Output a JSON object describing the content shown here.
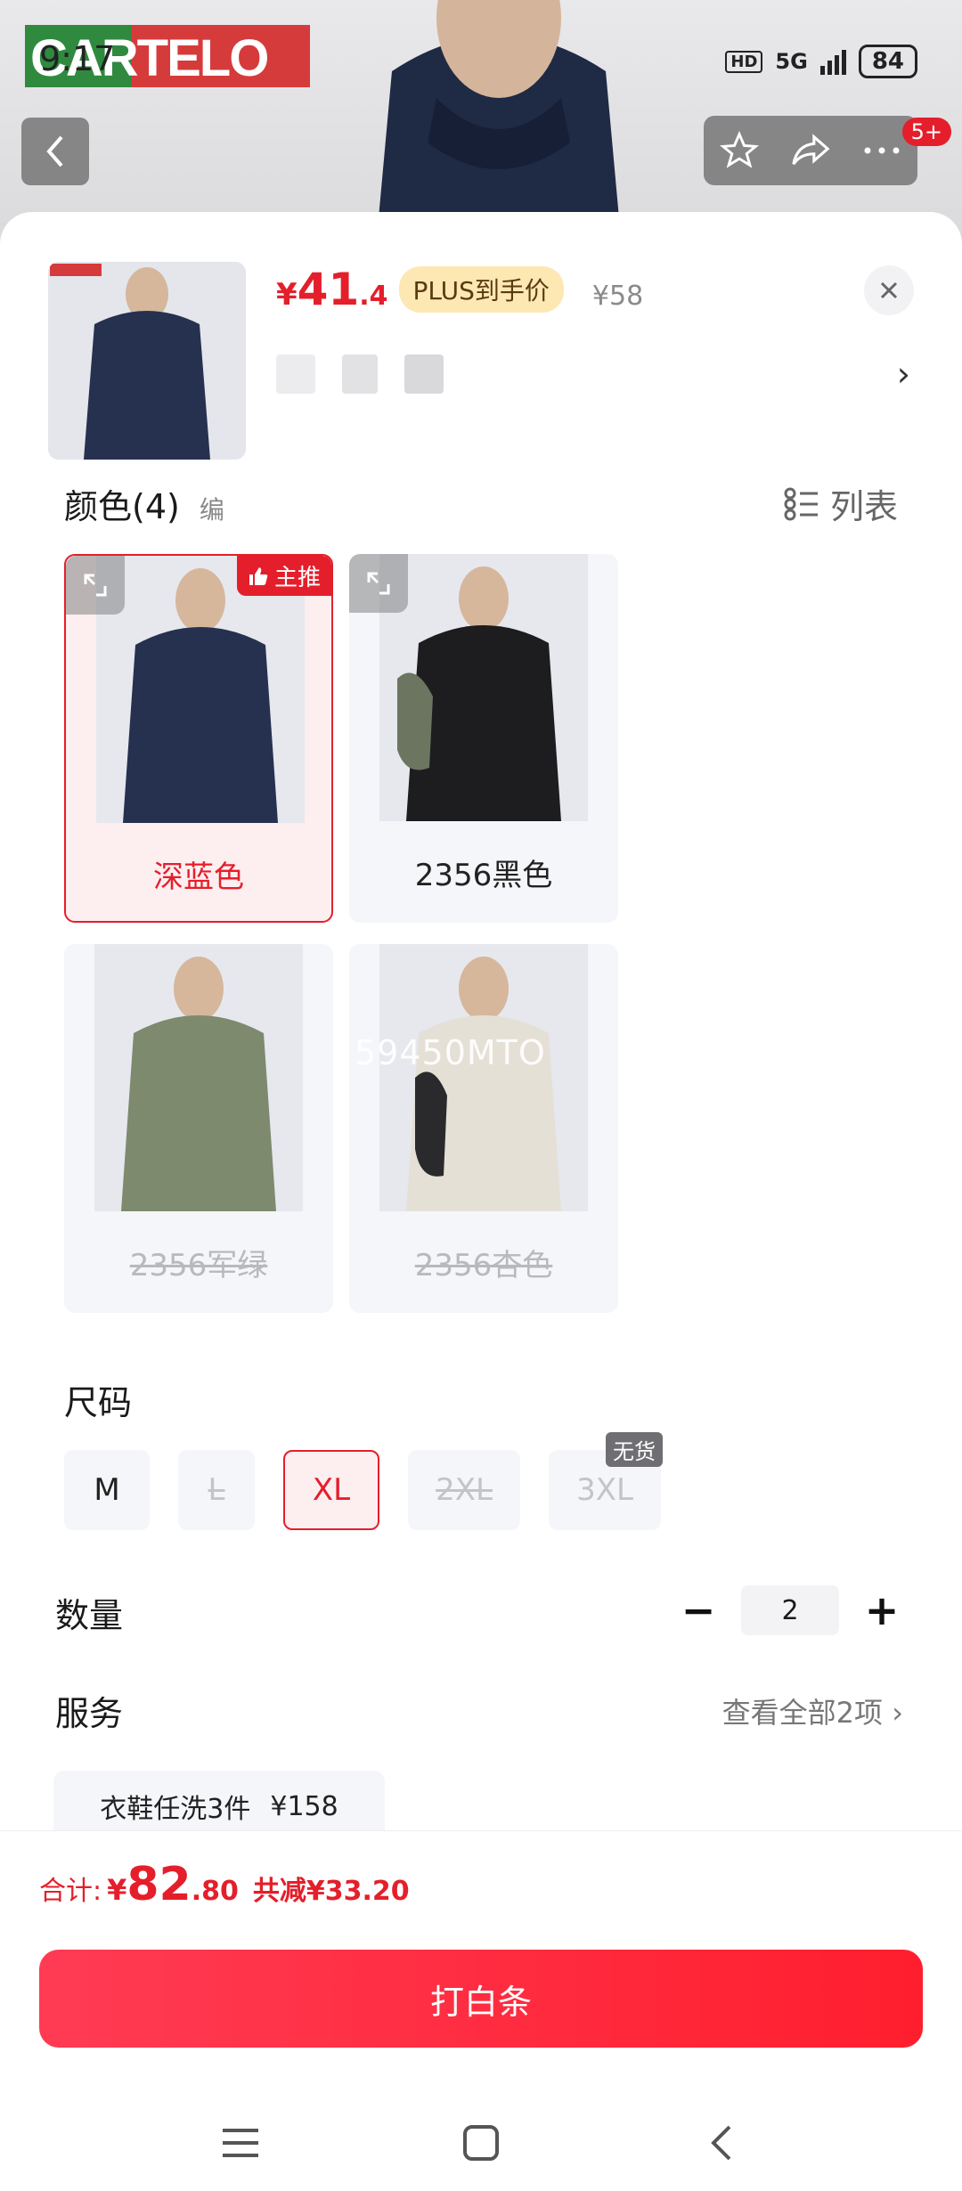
{
  "status_bar": {
    "time": "9:17",
    "network": "5G",
    "hd": "HD",
    "battery": "84"
  },
  "brand": {
    "logo_text": "CARTELO"
  },
  "header": {
    "badge_count": "5+"
  },
  "product": {
    "price_symbol": "¥",
    "price_int": "41",
    "price_dec": ".4",
    "plus_tag": "PLUS到手价",
    "original_price": "¥58"
  },
  "colors": {
    "title": "颜色(4)",
    "edit_hint": "编",
    "view_toggle": "列表",
    "main_tag": "主推",
    "overlay_code": "59450MTO",
    "items": [
      {
        "label": "深蓝色",
        "state": "selected",
        "swatch": "#26314f"
      },
      {
        "label": "2356黑色",
        "state": "normal",
        "swatch": "#1d1d1f"
      },
      {
        "label": "2356军绿",
        "state": "disabled",
        "swatch": "#7d8a6e"
      },
      {
        "label": "2356杏色",
        "state": "disabled",
        "swatch": "#e4e0d6"
      }
    ]
  },
  "sizes": {
    "title": "尺码",
    "no_stock_tag": "无货",
    "items": [
      {
        "label": "M",
        "state": "normal"
      },
      {
        "label": "L",
        "state": "disabled"
      },
      {
        "label": "XL",
        "state": "selected"
      },
      {
        "label": "2XL",
        "state": "disabled"
      },
      {
        "label": "3XL",
        "state": "nostock"
      }
    ]
  },
  "quantity": {
    "title": "数量",
    "value": "2",
    "minus": "−",
    "plus": "+"
  },
  "service": {
    "title": "服务",
    "view_all": "查看全部2项",
    "chip_name": "衣鞋任洗3件",
    "chip_price": "¥158"
  },
  "footer": {
    "total_label": "合计:",
    "total_symbol": "¥",
    "total_int": "82",
    "total_dec": ".80",
    "saving": "共减¥33.20",
    "buy_label": "打白条"
  },
  "colors_theme": {
    "accent": "#e41f2b",
    "selected_bg": "#fdeef0",
    "plus_bg": "#fde8b4"
  }
}
